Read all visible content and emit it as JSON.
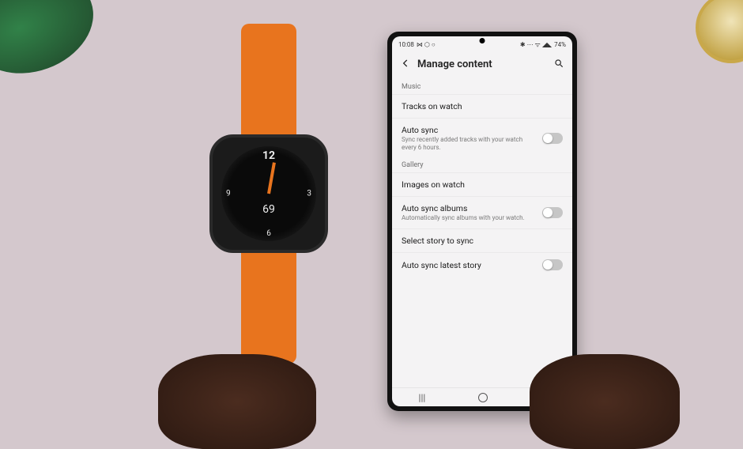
{
  "watch": {
    "n12": "12",
    "n3": "3",
    "n6": "6",
    "n9": "9",
    "reading": "69"
  },
  "phone": {
    "status": {
      "time": "10:08",
      "left_icons": "⋈ ⬡ ○",
      "right_icons": "✱ ⋯ ᯤ ◢◣",
      "battery": "74%"
    },
    "header": {
      "title": "Manage content"
    },
    "sections": {
      "music": {
        "header": "Music",
        "tracks_label": "Tracks on watch",
        "autosync_label": "Auto sync",
        "autosync_sub": "Sync recently added tracks with your watch every 6 hours."
      },
      "gallery": {
        "header": "Gallery",
        "images_label": "Images on watch",
        "albums_label": "Auto sync albums",
        "albums_sub": "Automatically sync albums with your watch.",
        "story_label": "Select story to sync",
        "latest_label": "Auto sync latest story"
      }
    }
  }
}
